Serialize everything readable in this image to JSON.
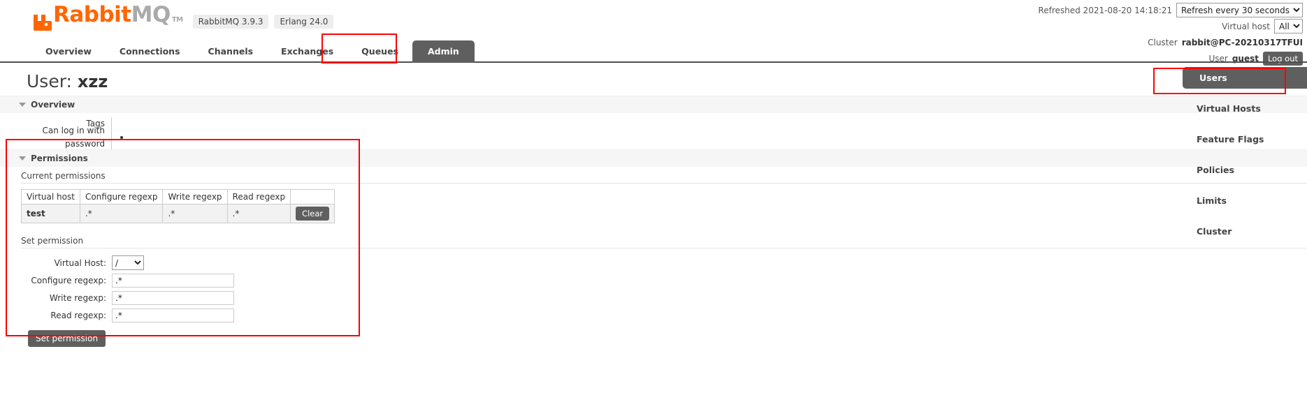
{
  "header": {
    "logo_rabbit": "Rabbit",
    "logo_mq": "MQ",
    "logo_tm": "TM",
    "version_badges": [
      "RabbitMQ 3.9.3",
      "Erlang 24.0"
    ],
    "refreshed_label": "Refreshed 2021-08-20 14:18:21",
    "refresh_select_value": "Refresh every 30 seconds",
    "refresh_options": [
      "Refresh every 30 seconds"
    ],
    "vhost_label": "Virtual host",
    "vhost_select_value": "All",
    "vhost_options": [
      "All"
    ],
    "cluster_label": "Cluster",
    "cluster_name": "rabbit@PC-20210317TFUI",
    "user_label": "User",
    "user_name": "guest",
    "logout_label": "Log out"
  },
  "nav": {
    "tabs": [
      {
        "label": "Overview",
        "active": false
      },
      {
        "label": "Connections",
        "active": false
      },
      {
        "label": "Channels",
        "active": false
      },
      {
        "label": "Exchanges",
        "active": false
      },
      {
        "label": "Queues",
        "active": false
      },
      {
        "label": "Admin",
        "active": true
      }
    ]
  },
  "main": {
    "page_title_prefix": "User:",
    "page_title_user": "xzz",
    "overview": {
      "section_label": "Overview",
      "rows": [
        {
          "key": "Tags",
          "value": ""
        },
        {
          "key": "Can log in with password",
          "value": "•"
        }
      ]
    },
    "permissions": {
      "section_label": "Permissions",
      "current_label": "Current permissions",
      "table": {
        "columns": [
          "Virtual host",
          "Configure regexp",
          "Write regexp",
          "Read regexp",
          ""
        ],
        "rows": [
          {
            "vhost": "test",
            "configure": ".*",
            "write": ".*",
            "read": ".*",
            "action": "Clear"
          }
        ]
      },
      "set_label": "Set permission",
      "form": {
        "vhost_label": "Virtual Host:",
        "vhost_value": "/",
        "vhost_options": [
          "/"
        ],
        "configure_label": "Configure regexp:",
        "configure_value": ".*",
        "write_label": "Write regexp:",
        "write_value": ".*",
        "read_label": "Read regexp:",
        "read_value": ".*",
        "submit_label": "Set permission"
      }
    }
  },
  "sidebar": {
    "items": [
      {
        "label": "Users",
        "active": true
      },
      {
        "label": "Virtual Hosts",
        "active": false
      },
      {
        "label": "Feature Flags",
        "active": false
      },
      {
        "label": "Policies",
        "active": false
      },
      {
        "label": "Limits",
        "active": false
      },
      {
        "label": "Cluster",
        "active": false
      }
    ]
  },
  "annotations": {
    "color": "#ff0000",
    "boxes": [
      "admin-tab",
      "users-sidebar-item",
      "permissions-section"
    ]
  }
}
